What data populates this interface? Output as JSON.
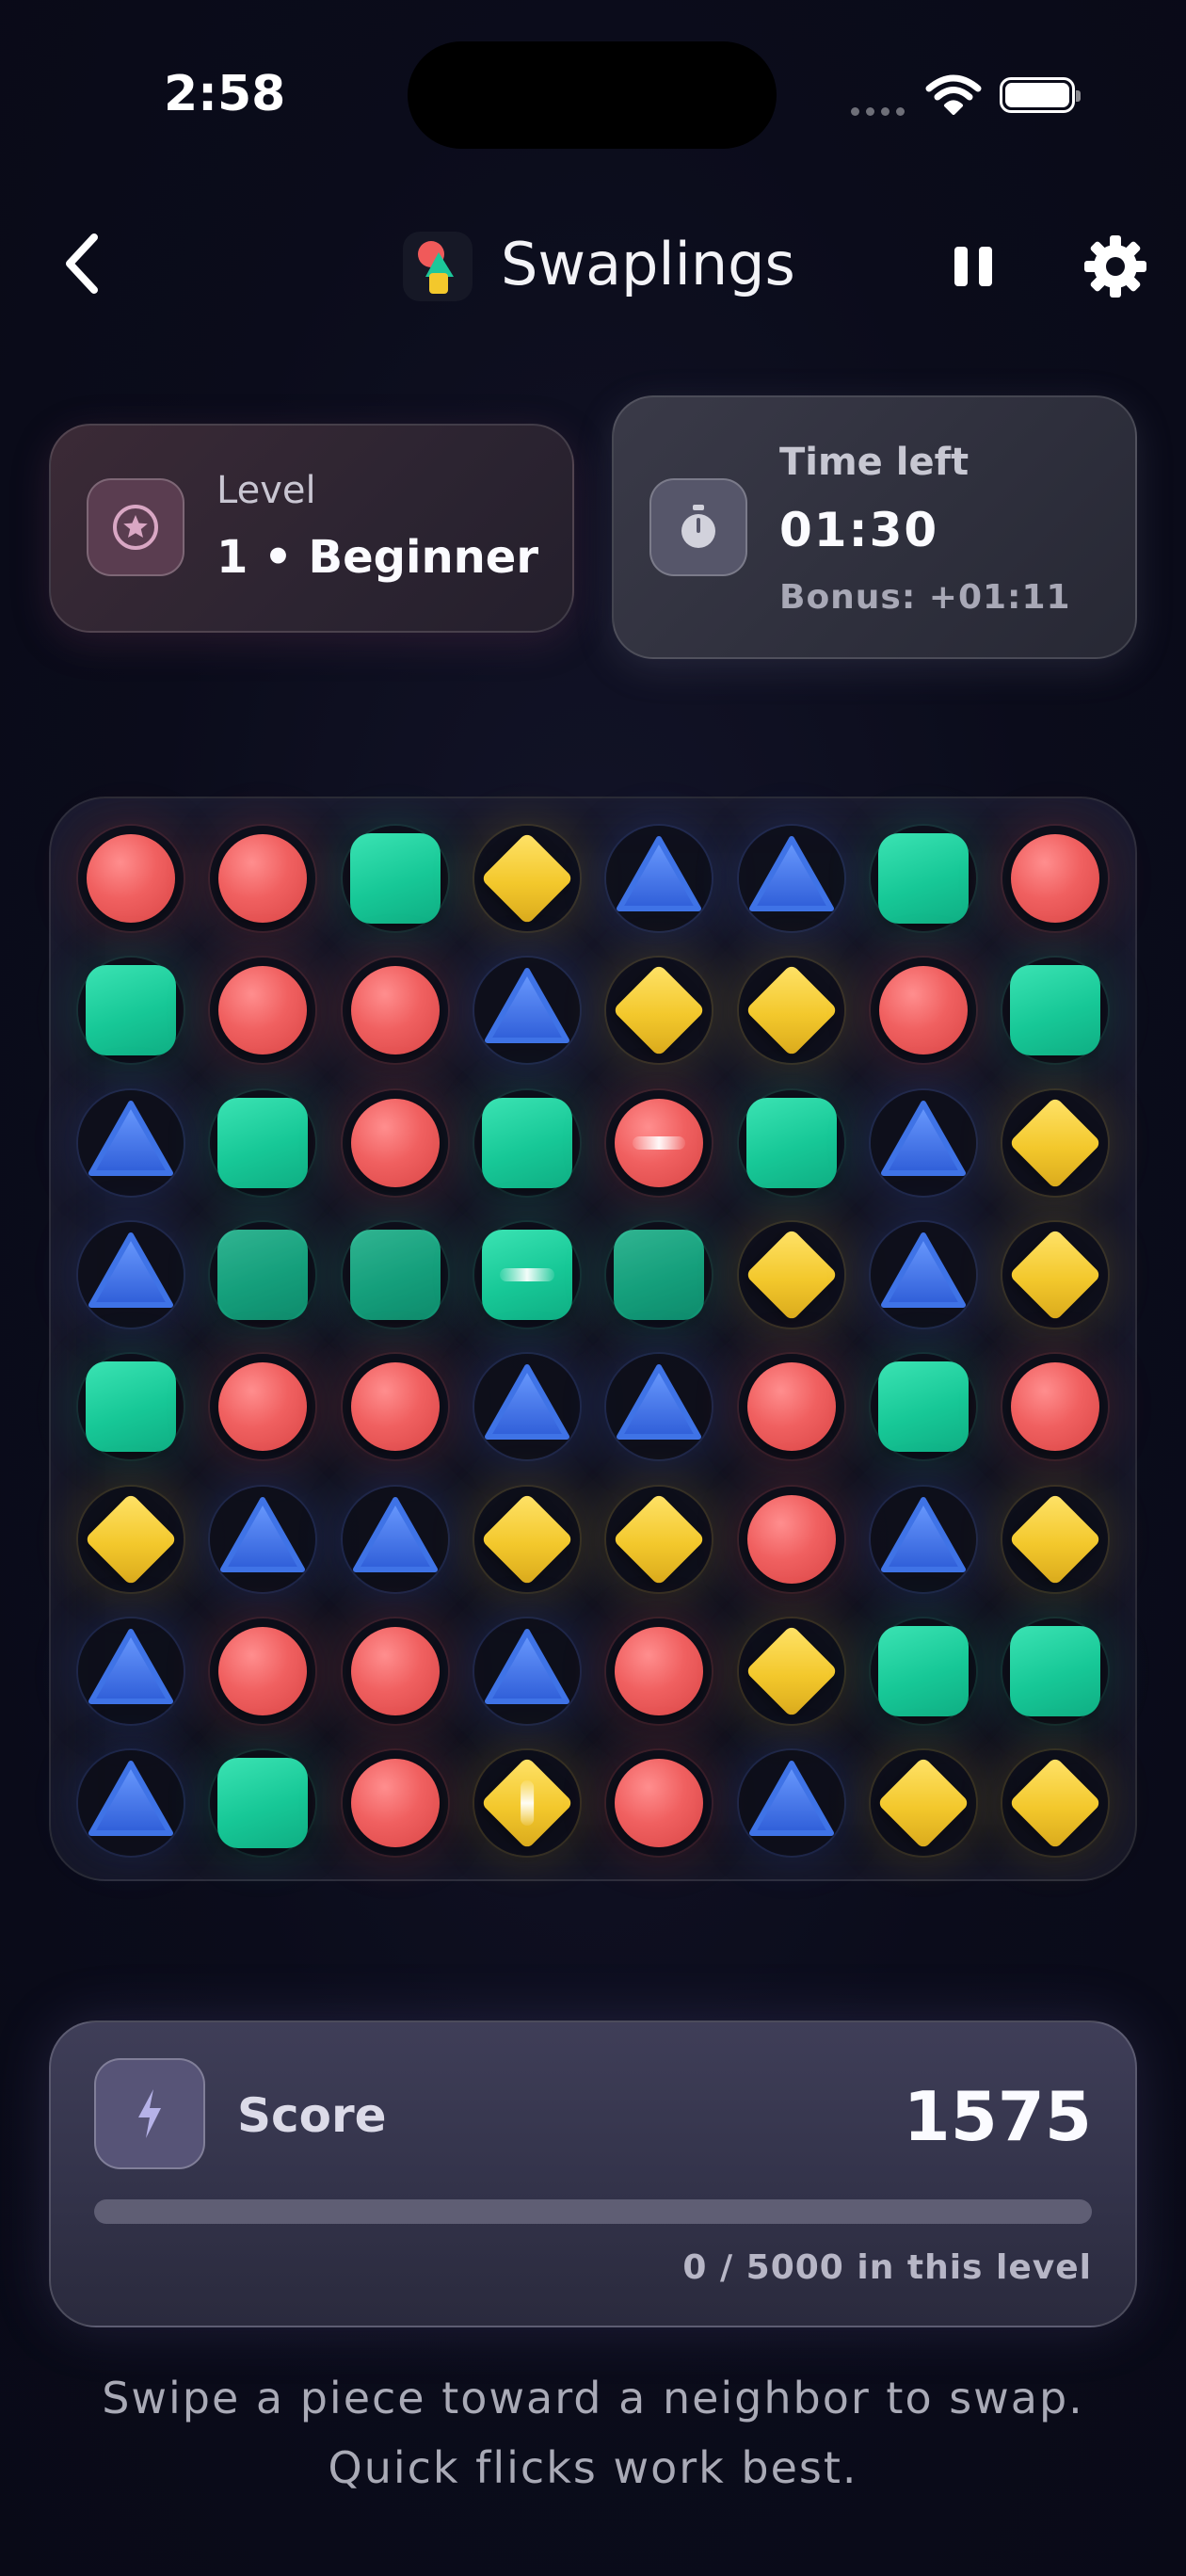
{
  "status_bar": {
    "time": "2:58"
  },
  "header": {
    "app_title": "Swaplings",
    "back_icon": "chevron-left-icon",
    "pause_icon": "pause-icon",
    "settings_icon": "gear-icon"
  },
  "level_card": {
    "label": "Level",
    "value": "1 • Beginner",
    "icon": "star-icon"
  },
  "time_card": {
    "label": "Time left",
    "value": "01:30",
    "bonus": "Bonus: +01:11",
    "icon": "stopwatch-icon"
  },
  "board": {
    "rows": [
      [
        "red-circle",
        "red-circle",
        "green-square",
        "yellow-diamond",
        "blue-triangle",
        "blue-triangle",
        "green-square",
        "red-circle"
      ],
      [
        "green-square",
        "red-circle",
        "red-circle",
        "blue-triangle",
        "yellow-diamond",
        "yellow-diamond",
        "red-circle",
        "green-square"
      ],
      [
        "blue-triangle",
        "green-square",
        "red-circle",
        "green-square",
        "red-circle-striped-h",
        "green-square",
        "blue-triangle",
        "yellow-diamond"
      ],
      [
        "blue-triangle",
        "green-square-matched",
        "green-square-matched",
        "green-square-striped-h",
        "green-square-matched",
        "yellow-diamond",
        "blue-triangle",
        "yellow-diamond"
      ],
      [
        "green-square",
        "red-circle",
        "red-circle",
        "blue-triangle",
        "blue-triangle",
        "red-circle",
        "green-square",
        "red-circle"
      ],
      [
        "yellow-diamond",
        "blue-triangle",
        "blue-triangle",
        "yellow-diamond",
        "yellow-diamond",
        "red-circle",
        "blue-triangle",
        "yellow-diamond"
      ],
      [
        "blue-triangle",
        "red-circle",
        "red-circle",
        "blue-triangle",
        "red-circle",
        "yellow-diamond",
        "green-square",
        "green-square"
      ],
      [
        "blue-triangle",
        "green-square",
        "red-circle",
        "yellow-diamond-striped-v",
        "red-circle",
        "blue-triangle",
        "yellow-diamond",
        "yellow-diamond"
      ]
    ],
    "colors": {
      "red": "#f06060",
      "green": "#17c897",
      "yellow": "#f3c82c",
      "blue": "#3f73e6"
    }
  },
  "score": {
    "label": "Score",
    "value": "1575",
    "progress_text": "0 / 5000 in this level",
    "progress_fraction": 0,
    "icon": "lightning-icon"
  },
  "hint": {
    "line1": "Swipe a piece toward a neighbor to swap.",
    "line2": "Quick flicks work best."
  }
}
